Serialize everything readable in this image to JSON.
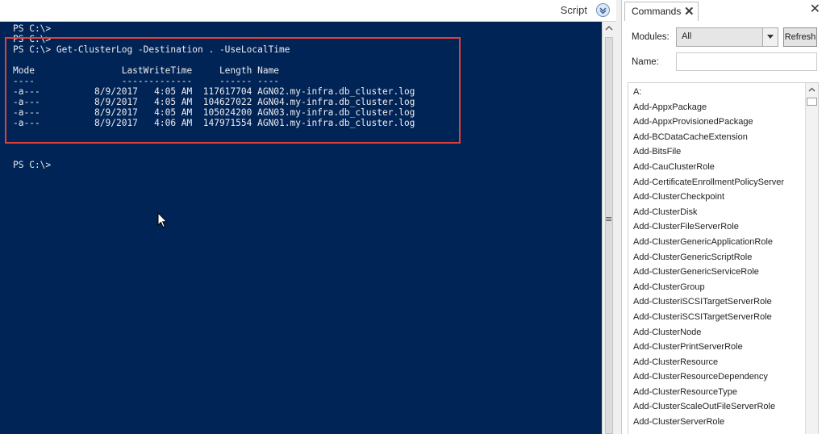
{
  "header": {
    "script_label": "Script"
  },
  "console": {
    "background": "#012456",
    "text_color": "#eeedf0",
    "highlight_color": "#e0403a",
    "lines": [
      "PS C:\\>",
      "PS C:\\>",
      "PS C:\\> Get-ClusterLog -Destination . -UseLocalTime",
      "Mode                LastWriteTime     Length Name",
      "----                -------------     ------ ----",
      "-a---          8/9/2017   4:05 AM  117617704 AGN02.my-infra.db_cluster.log",
      "-a---          8/9/2017   4:05 AM  104627022 AGN04.my-infra.db_cluster.log",
      "-a---          8/9/2017   4:05 AM  105024200 AGN03.my-infra.db_cluster.log",
      "-a---          8/9/2017   4:06 AM  147971554 AGN01.my-infra.db_cluster.log",
      "PS C:\\>"
    ]
  },
  "commands_pane": {
    "tab_label": "Commands",
    "tab_close_glyph": "✕",
    "pane_close_glyph": "✕",
    "modules_label": "Modules:",
    "modules_value": "All",
    "refresh_label": "Refresh",
    "name_label": "Name:",
    "name_value": "",
    "commands": [
      "A:",
      "Add-AppxPackage",
      "Add-AppxProvisionedPackage",
      "Add-BCDataCacheExtension",
      "Add-BitsFile",
      "Add-CauClusterRole",
      "Add-CertificateEnrollmentPolicyServer",
      "Add-ClusterCheckpoint",
      "Add-ClusterDisk",
      "Add-ClusterFileServerRole",
      "Add-ClusterGenericApplicationRole",
      "Add-ClusterGenericScriptRole",
      "Add-ClusterGenericServiceRole",
      "Add-ClusterGroup",
      "Add-ClusteriSCSITargetServerRole",
      "Add-ClusteriSCSITargetServerRole",
      "Add-ClusterNode",
      "Add-ClusterPrintServerRole",
      "Add-ClusterResource",
      "Add-ClusterResourceDependency",
      "Add-ClusterResourceType",
      "Add-ClusterScaleOutFileServerRole",
      "Add-ClusterServerRole"
    ]
  },
  "icons": {
    "script_toggle": "chevron-down-circle-icon",
    "cursor": "mouse-pointer-icon",
    "splitter": "grip-icon"
  }
}
